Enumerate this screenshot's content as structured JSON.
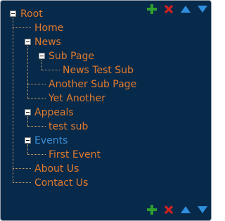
{
  "colors": {
    "panel_bg": "#082a4a",
    "link": "#e07a2c",
    "selected": "#3a8fd6",
    "add": "#2ea02e",
    "delete": "#d42020",
    "arrow": "#2f8fdf"
  },
  "toolbar": {
    "icons": [
      "add-icon",
      "delete-icon",
      "arrow-up-icon",
      "arrow-down-icon"
    ]
  },
  "tree": {
    "root": "Root",
    "home": "Home",
    "news": "News",
    "sub_page": "Sub Page",
    "news_test_sub": "News Test Sub",
    "another_sub_page": "Another Sub Page",
    "yet_another": "Yet Another",
    "appeals": "Appeals",
    "test_sub": "test sub",
    "events": "Events",
    "first_event": "First Event",
    "about_us": "About Us",
    "contact_us": "Contact Us"
  }
}
